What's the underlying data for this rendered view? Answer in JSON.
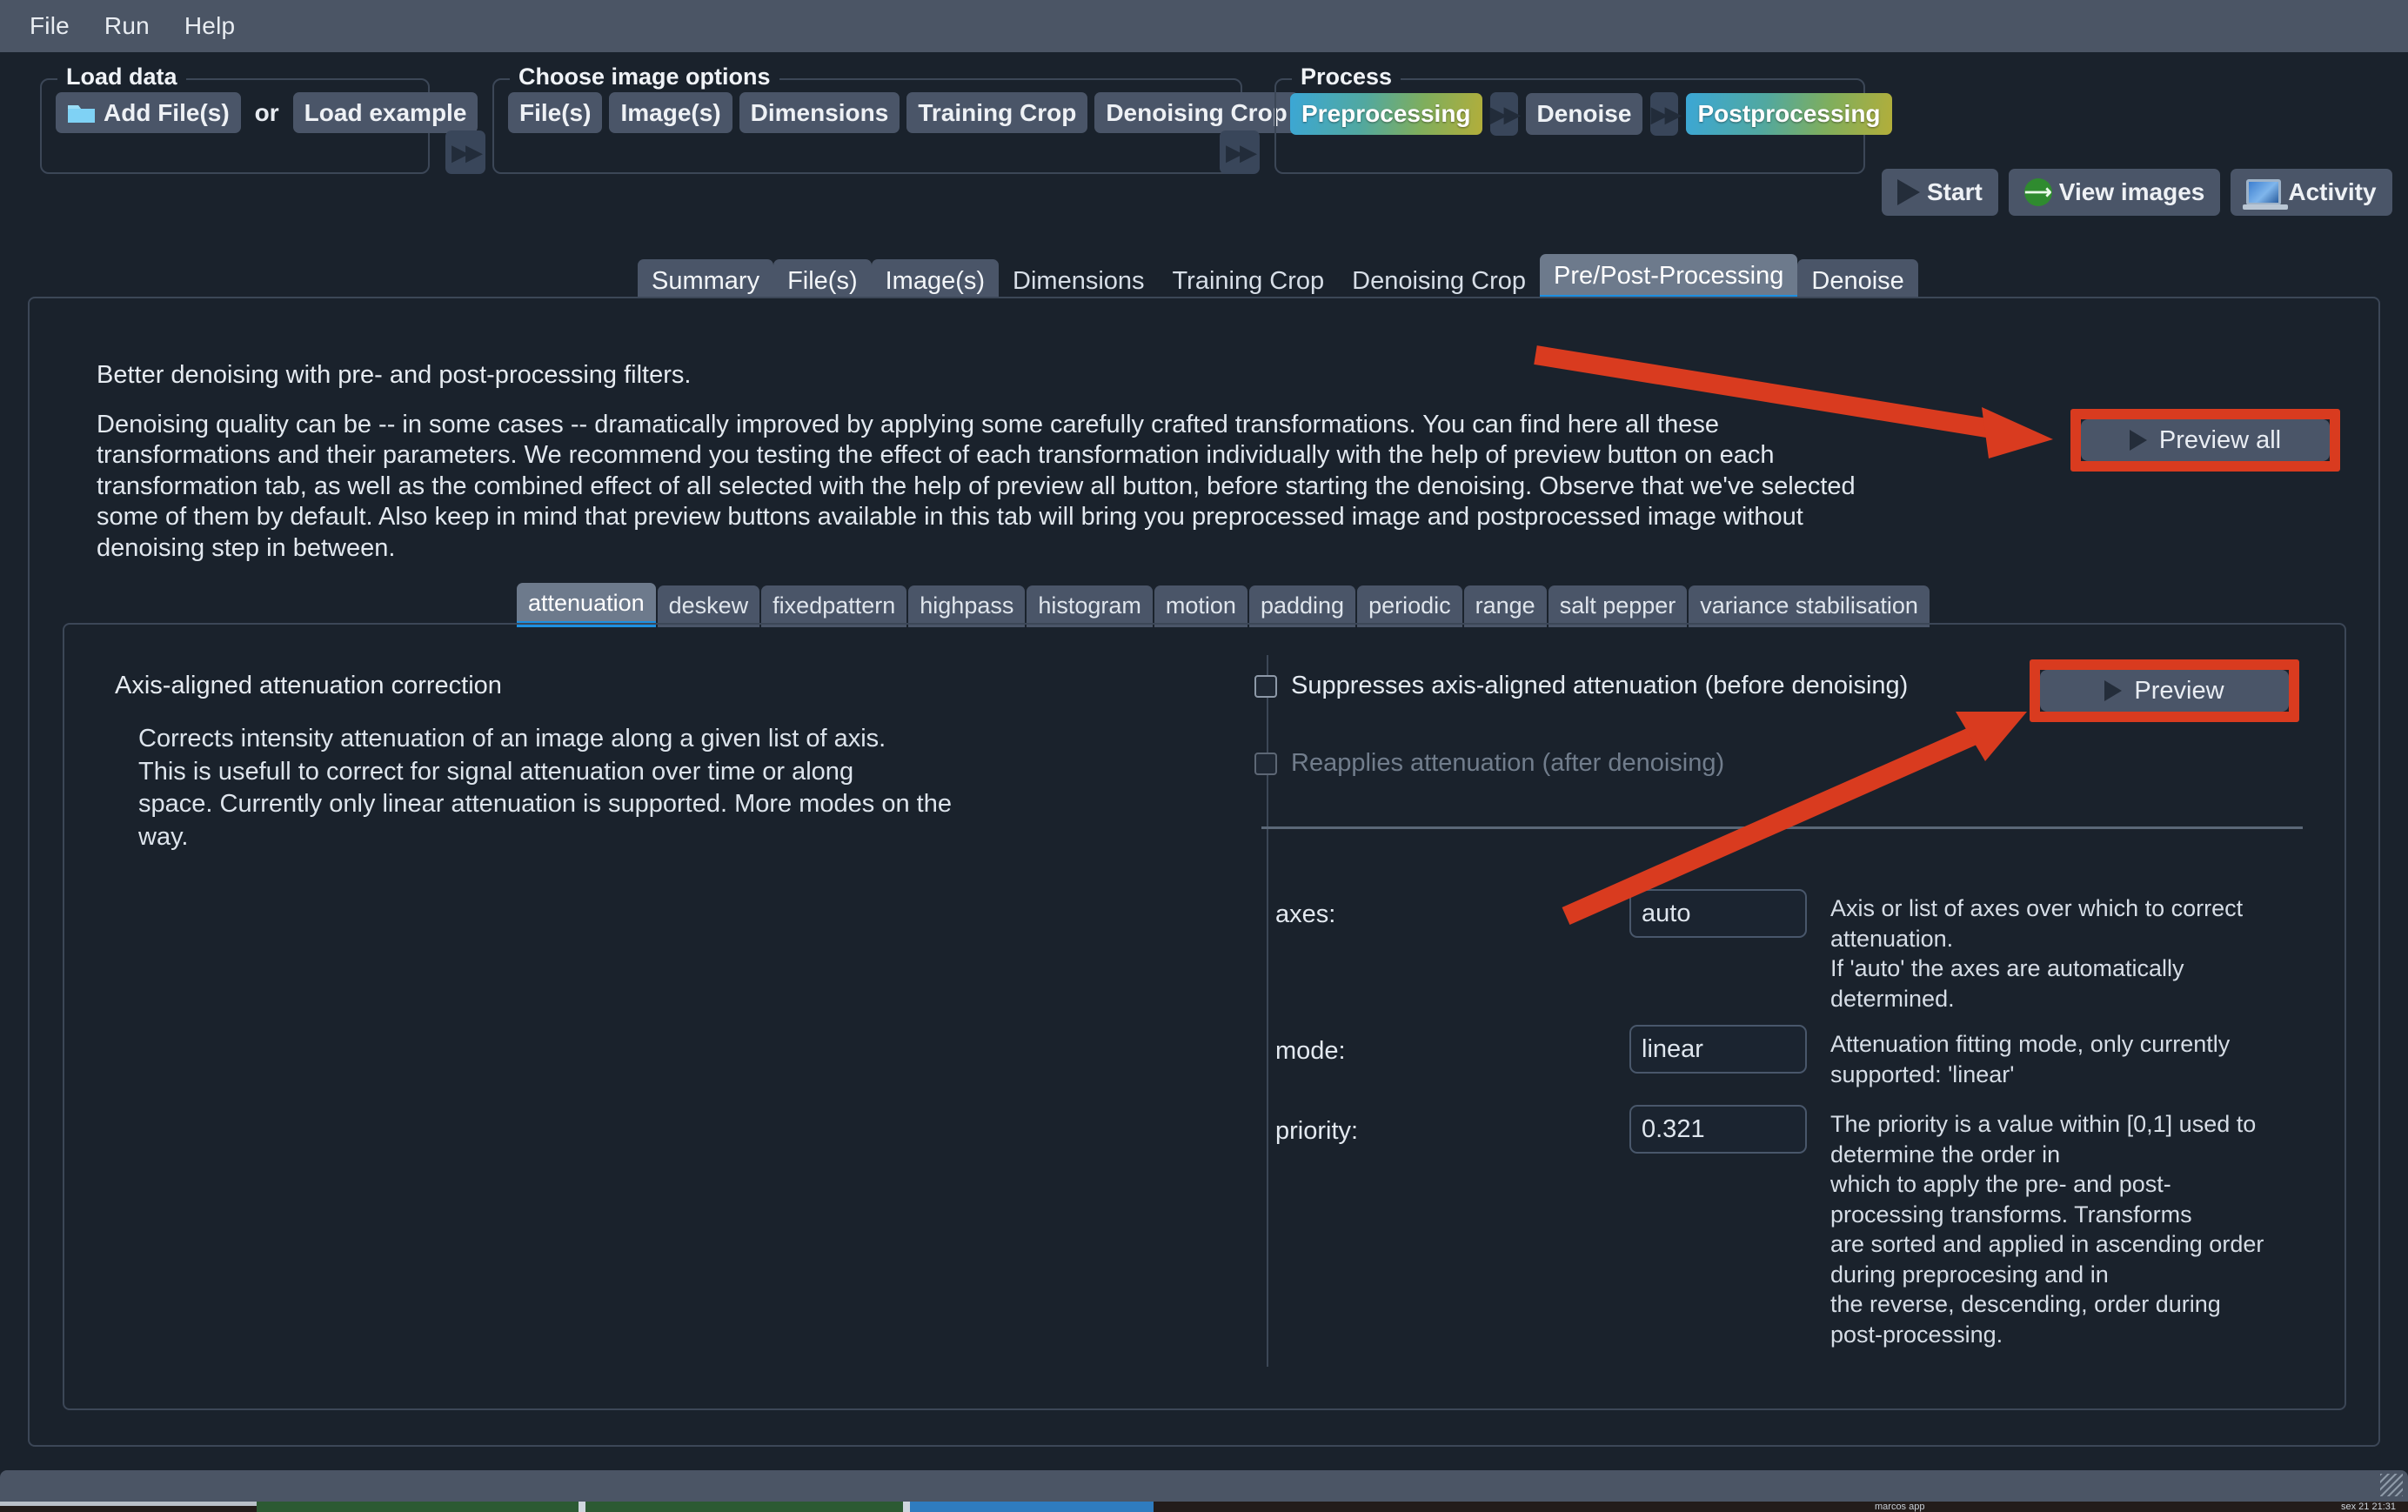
{
  "menubar": {
    "items": [
      "File",
      "Run",
      "Help"
    ]
  },
  "toolbar": {
    "load_data": {
      "title": "Load data",
      "add_files": "Add File(s)",
      "or": "or",
      "load_example": "Load example",
      "folder_icon": "folder-icon",
      "next_icon": "fast-forward-icon"
    },
    "image_options": {
      "title": "Choose image options",
      "buttons": [
        "File(s)",
        "Image(s)",
        "Dimensions",
        "Training Crop",
        "Denoising Crop"
      ],
      "next_icon": "fast-forward-icon"
    },
    "process": {
      "title": "Process",
      "preprocessing": "Preprocessing",
      "denoise": "Denoise",
      "postprocessing": "Postprocessing",
      "next_icon": "fast-forward-icon",
      "gradient_start": "#3ba7d6",
      "gradient_end": "#b3ae3a"
    },
    "actions": {
      "start": "Start",
      "view_images": "View images",
      "activity": "Activity"
    }
  },
  "main_tabs": {
    "items": [
      {
        "label": "Summary",
        "state": "lit"
      },
      {
        "label": "File(s)",
        "state": "lit"
      },
      {
        "label": "Image(s)",
        "state": "lit"
      },
      {
        "label": "Dimensions",
        "state": "plain"
      },
      {
        "label": "Training Crop",
        "state": "plain"
      },
      {
        "label": "Denoising Crop",
        "state": "plain"
      },
      {
        "label": "Pre/Post-Processing",
        "state": "active"
      },
      {
        "label": "Denoise",
        "state": "lit"
      }
    ],
    "active_accent": "#1e8fe0"
  },
  "content": {
    "heading": "Better denoising with pre- and post-processing filters.",
    "paragraph": "Denoising quality can be -- in some cases -- dramatically improved by applying some carefully crafted transformations. You can find here all these transformations and their parameters. We recommend you testing the effect of each transformation individually with the help of preview button on each transformation tab, as well as the combined effect of all selected with the help of preview all button, before starting the denoising. Observe that we've selected some of them by default. Also keep in mind that preview buttons available in this tab will bring you preprocessed image and postprocessed image without denoising step in between.",
    "preview_all_label": "Preview all",
    "annotation_color": "#d93b1f"
  },
  "sub_tabs": {
    "items": [
      "attenuation",
      "deskew",
      "fixedpattern",
      "highpass",
      "histogram",
      "motion",
      "padding",
      "periodic",
      "range",
      "salt pepper",
      "variance stabilisation"
    ],
    "active": "attenuation"
  },
  "transform": {
    "title": "Axis-aligned attenuation correction",
    "description": "Corrects intensity attenuation of an image along a given list of axis.\nThis is usefull to correct for signal attenuation over time or along\nspace. Currently only linear attenuation is supported. More modes on the\nway.",
    "checkbox_before": {
      "label": "Suppresses axis-aligned attenuation (before denoising)",
      "checked": false,
      "disabled": false
    },
    "checkbox_after": {
      "label": "Reapplies attenuation (after denoising)",
      "checked": false,
      "disabled": true
    },
    "preview_label": "Preview",
    "params": [
      {
        "label": "axes:",
        "value": "auto",
        "description": "Axis or list of axes over which to correct\nattenuation.\nIf 'auto' the axes are automatically\ndetermined."
      },
      {
        "label": "mode:",
        "value": "linear",
        "description": "Attenuation fitting mode, only currently\nsupported: 'linear'"
      },
      {
        "label": "priority:",
        "value": "0.321",
        "description": "The priority is a value within [0,1] used to\ndetermine the order in\nwhich to apply the pre- and post-\nprocessing transforms. Transforms\nare sorted and applied in ascending order\nduring preprocesing and in\nthe reverse, descending, order during\npost-processing."
      }
    ]
  },
  "os_taskbar": {
    "window_label": "marcos app",
    "clock": "sex 21  21:31",
    "segments": [
      "#2c5a33",
      "#2c5a33",
      "#2f7cbf",
      "#231c1a",
      "#231c1a"
    ]
  }
}
